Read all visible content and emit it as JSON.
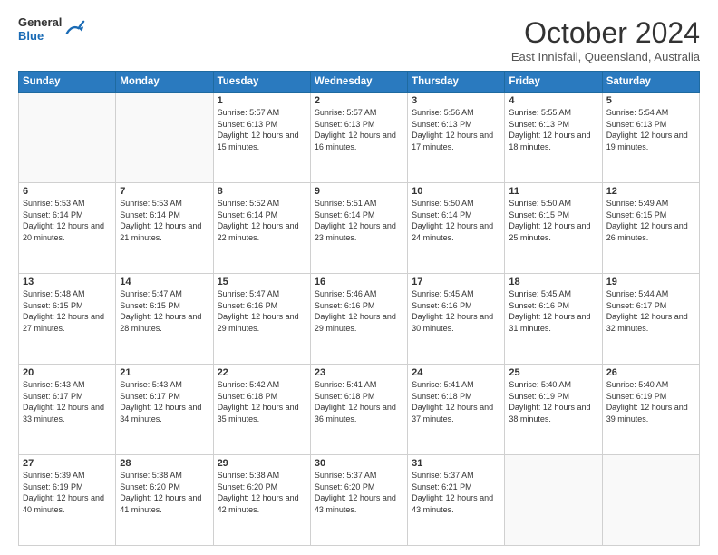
{
  "header": {
    "logo_general": "General",
    "logo_blue": "Blue",
    "month_title": "October 2024",
    "location": "East Innisfail, Queensland, Australia"
  },
  "weekdays": [
    "Sunday",
    "Monday",
    "Tuesday",
    "Wednesday",
    "Thursday",
    "Friday",
    "Saturday"
  ],
  "weeks": [
    [
      {
        "num": "",
        "info": ""
      },
      {
        "num": "",
        "info": ""
      },
      {
        "num": "1",
        "info": "Sunrise: 5:57 AM\nSunset: 6:13 PM\nDaylight: 12 hours and 15 minutes."
      },
      {
        "num": "2",
        "info": "Sunrise: 5:57 AM\nSunset: 6:13 PM\nDaylight: 12 hours and 16 minutes."
      },
      {
        "num": "3",
        "info": "Sunrise: 5:56 AM\nSunset: 6:13 PM\nDaylight: 12 hours and 17 minutes."
      },
      {
        "num": "4",
        "info": "Sunrise: 5:55 AM\nSunset: 6:13 PM\nDaylight: 12 hours and 18 minutes."
      },
      {
        "num": "5",
        "info": "Sunrise: 5:54 AM\nSunset: 6:13 PM\nDaylight: 12 hours and 19 minutes."
      }
    ],
    [
      {
        "num": "6",
        "info": "Sunrise: 5:53 AM\nSunset: 6:14 PM\nDaylight: 12 hours and 20 minutes."
      },
      {
        "num": "7",
        "info": "Sunrise: 5:53 AM\nSunset: 6:14 PM\nDaylight: 12 hours and 21 minutes."
      },
      {
        "num": "8",
        "info": "Sunrise: 5:52 AM\nSunset: 6:14 PM\nDaylight: 12 hours and 22 minutes."
      },
      {
        "num": "9",
        "info": "Sunrise: 5:51 AM\nSunset: 6:14 PM\nDaylight: 12 hours and 23 minutes."
      },
      {
        "num": "10",
        "info": "Sunrise: 5:50 AM\nSunset: 6:14 PM\nDaylight: 12 hours and 24 minutes."
      },
      {
        "num": "11",
        "info": "Sunrise: 5:50 AM\nSunset: 6:15 PM\nDaylight: 12 hours and 25 minutes."
      },
      {
        "num": "12",
        "info": "Sunrise: 5:49 AM\nSunset: 6:15 PM\nDaylight: 12 hours and 26 minutes."
      }
    ],
    [
      {
        "num": "13",
        "info": "Sunrise: 5:48 AM\nSunset: 6:15 PM\nDaylight: 12 hours and 27 minutes."
      },
      {
        "num": "14",
        "info": "Sunrise: 5:47 AM\nSunset: 6:15 PM\nDaylight: 12 hours and 28 minutes."
      },
      {
        "num": "15",
        "info": "Sunrise: 5:47 AM\nSunset: 6:16 PM\nDaylight: 12 hours and 29 minutes."
      },
      {
        "num": "16",
        "info": "Sunrise: 5:46 AM\nSunset: 6:16 PM\nDaylight: 12 hours and 29 minutes."
      },
      {
        "num": "17",
        "info": "Sunrise: 5:45 AM\nSunset: 6:16 PM\nDaylight: 12 hours and 30 minutes."
      },
      {
        "num": "18",
        "info": "Sunrise: 5:45 AM\nSunset: 6:16 PM\nDaylight: 12 hours and 31 minutes."
      },
      {
        "num": "19",
        "info": "Sunrise: 5:44 AM\nSunset: 6:17 PM\nDaylight: 12 hours and 32 minutes."
      }
    ],
    [
      {
        "num": "20",
        "info": "Sunrise: 5:43 AM\nSunset: 6:17 PM\nDaylight: 12 hours and 33 minutes."
      },
      {
        "num": "21",
        "info": "Sunrise: 5:43 AM\nSunset: 6:17 PM\nDaylight: 12 hours and 34 minutes."
      },
      {
        "num": "22",
        "info": "Sunrise: 5:42 AM\nSunset: 6:18 PM\nDaylight: 12 hours and 35 minutes."
      },
      {
        "num": "23",
        "info": "Sunrise: 5:41 AM\nSunset: 6:18 PM\nDaylight: 12 hours and 36 minutes."
      },
      {
        "num": "24",
        "info": "Sunrise: 5:41 AM\nSunset: 6:18 PM\nDaylight: 12 hours and 37 minutes."
      },
      {
        "num": "25",
        "info": "Sunrise: 5:40 AM\nSunset: 6:19 PM\nDaylight: 12 hours and 38 minutes."
      },
      {
        "num": "26",
        "info": "Sunrise: 5:40 AM\nSunset: 6:19 PM\nDaylight: 12 hours and 39 minutes."
      }
    ],
    [
      {
        "num": "27",
        "info": "Sunrise: 5:39 AM\nSunset: 6:19 PM\nDaylight: 12 hours and 40 minutes."
      },
      {
        "num": "28",
        "info": "Sunrise: 5:38 AM\nSunset: 6:20 PM\nDaylight: 12 hours and 41 minutes."
      },
      {
        "num": "29",
        "info": "Sunrise: 5:38 AM\nSunset: 6:20 PM\nDaylight: 12 hours and 42 minutes."
      },
      {
        "num": "30",
        "info": "Sunrise: 5:37 AM\nSunset: 6:20 PM\nDaylight: 12 hours and 43 minutes."
      },
      {
        "num": "31",
        "info": "Sunrise: 5:37 AM\nSunset: 6:21 PM\nDaylight: 12 hours and 43 minutes."
      },
      {
        "num": "",
        "info": ""
      },
      {
        "num": "",
        "info": ""
      }
    ]
  ]
}
